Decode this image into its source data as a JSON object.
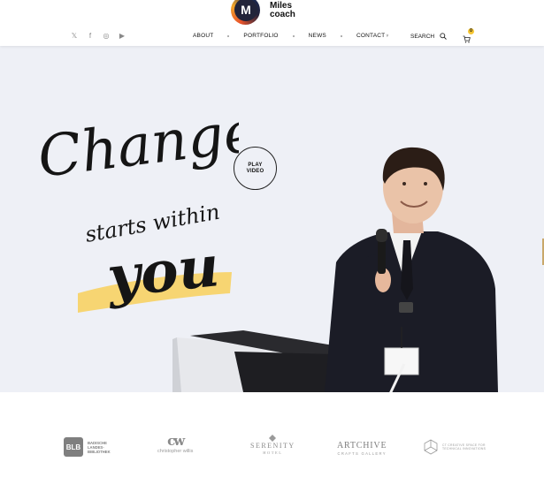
{
  "header": {
    "logo": {
      "letter": "M",
      "line1": "Miles",
      "line2": "coach"
    },
    "social": [
      {
        "name": "twitter-icon",
        "glyph": "𝕏"
      },
      {
        "name": "facebook-icon",
        "glyph": "f"
      },
      {
        "name": "instagram-icon",
        "glyph": "◎"
      },
      {
        "name": "youtube-icon",
        "glyph": "▶"
      }
    ],
    "nav": [
      {
        "label": "ABOUT"
      },
      {
        "label": "PORTFOLIO"
      },
      {
        "label": "NEWS"
      },
      {
        "label": "CONTACT"
      }
    ],
    "search_label": "SEARCH",
    "cart_count": "0"
  },
  "hero": {
    "headline": {
      "line1": "Change",
      "line2": "starts within",
      "line3": "you"
    },
    "play_line1": "PLAY",
    "play_line2": "VIDEO",
    "accent_color": "#f7d36a",
    "background_color": "#eef0f6"
  },
  "clients": [
    {
      "key": "blb",
      "mark": "BLB",
      "text": "BADISCHE LANDES- BIBLIOTHEK"
    },
    {
      "key": "cw",
      "mark": "cw",
      "text": "christopher willis"
    },
    {
      "key": "serenity",
      "mark": "SERENITY",
      "text": "HOTEL"
    },
    {
      "key": "archive",
      "mark": "ARTCHIVE",
      "text": "CRAFTS GALLERY"
    },
    {
      "key": "ct",
      "mark": "",
      "text": "CT CREATIVE SPACE FOR TECHNICAL INNOVATIONS"
    }
  ]
}
